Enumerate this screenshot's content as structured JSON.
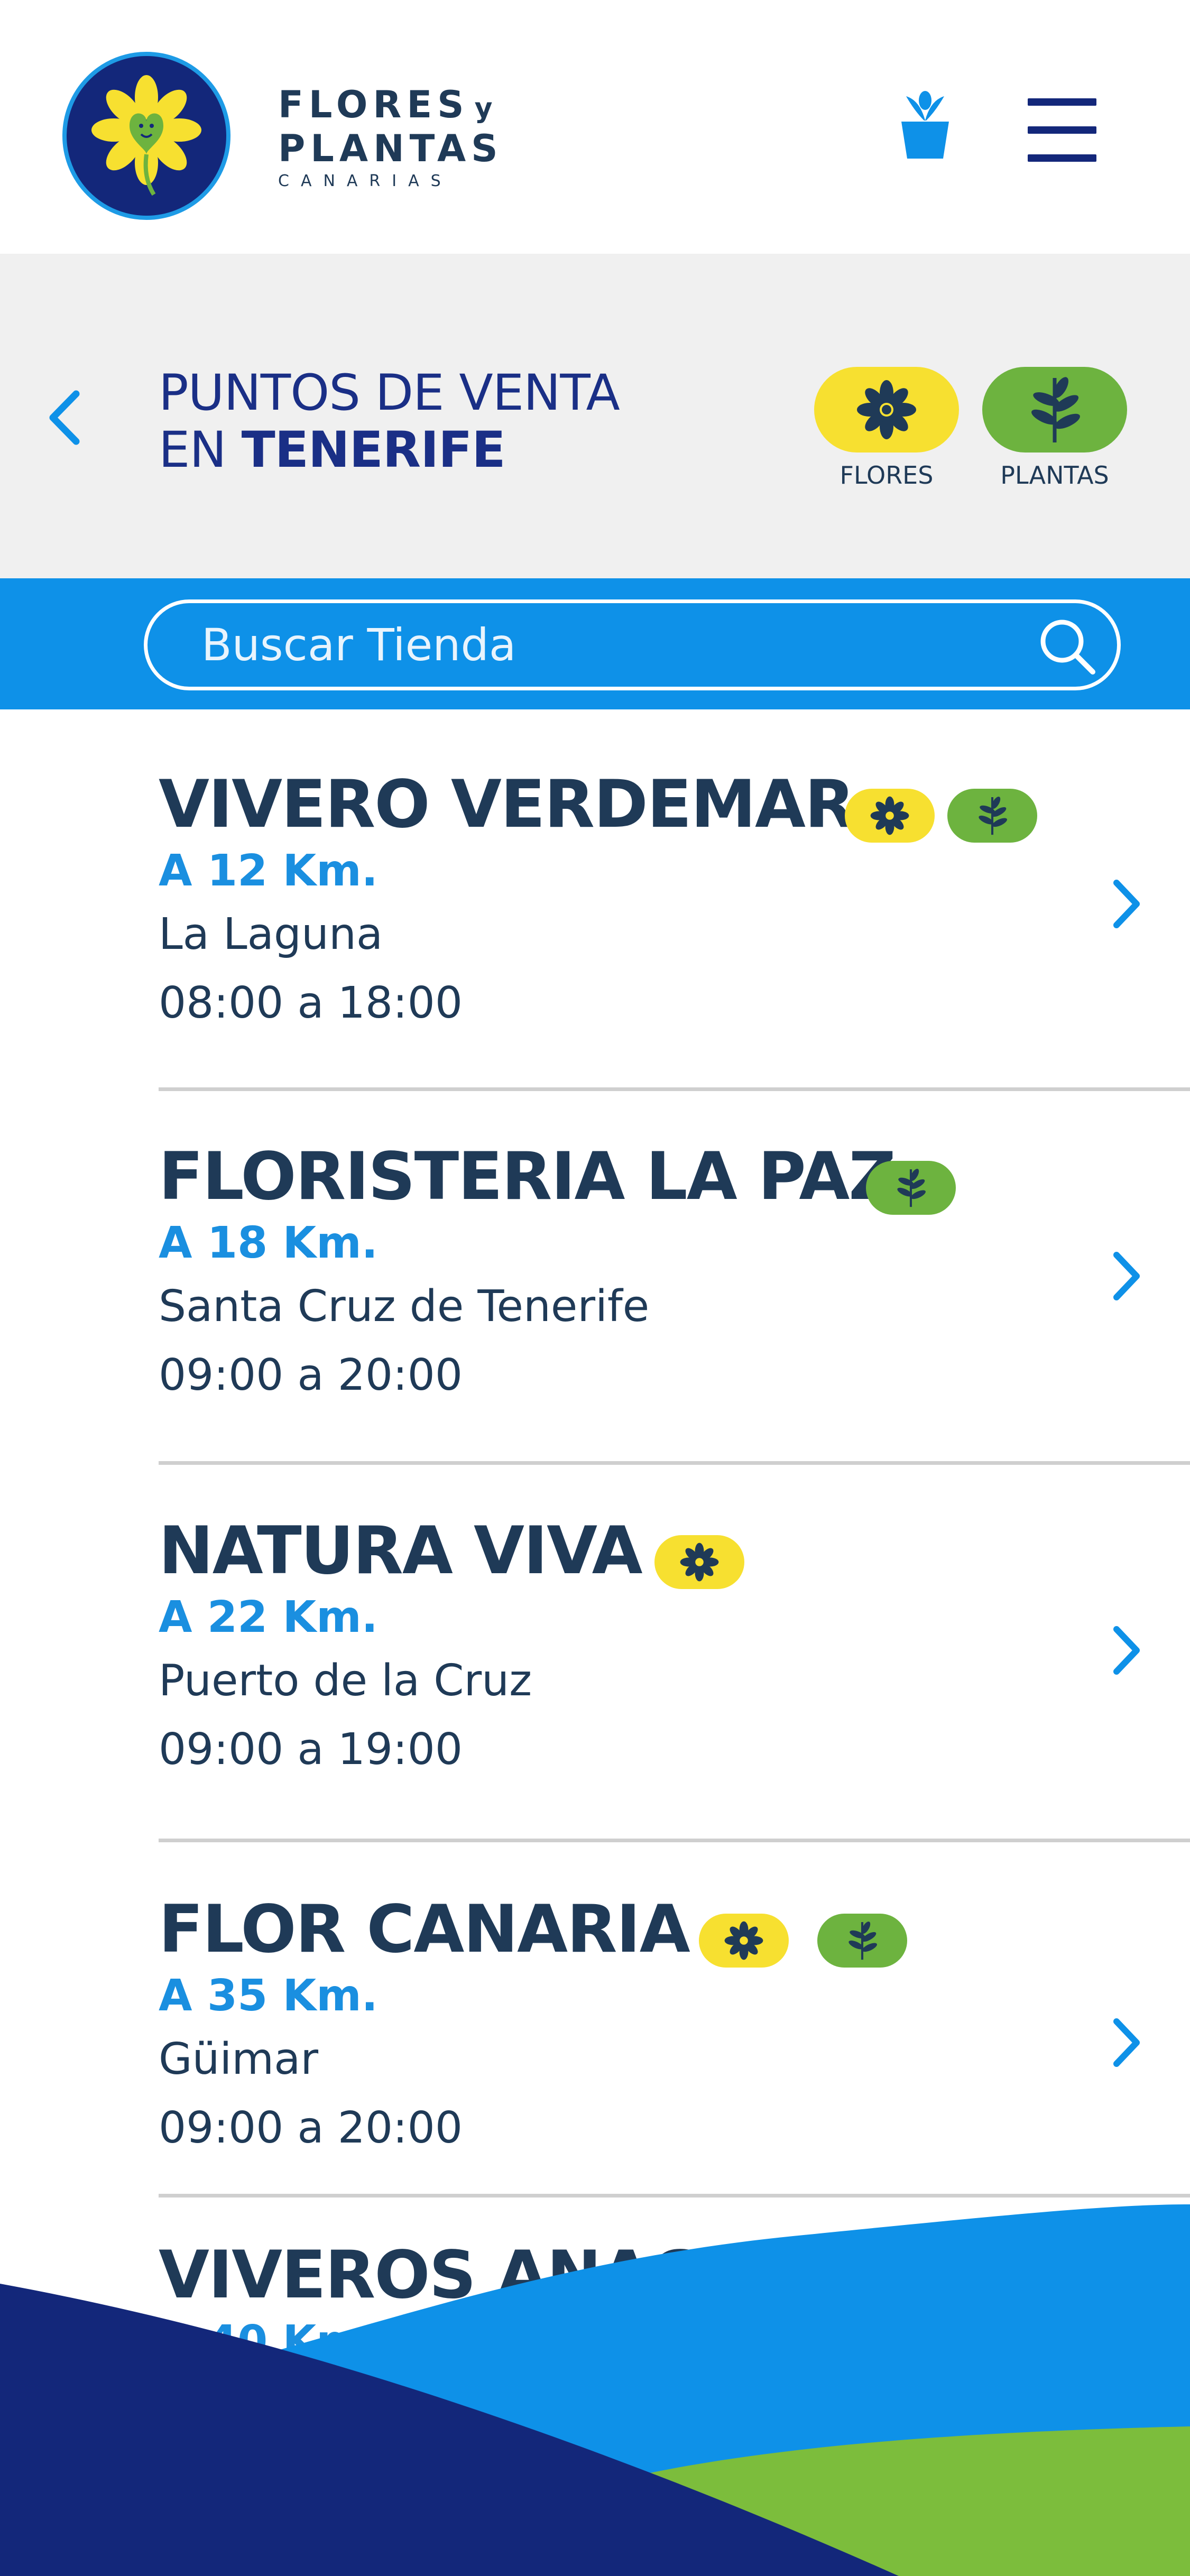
{
  "brand": {
    "line1": "FLORES",
    "line1_small": "y",
    "line2": "PLANTAS",
    "line3": "CANARIAS"
  },
  "icons": {
    "gift": "flower-pot-icon",
    "menu": "hamburger-menu-icon",
    "back": "chevron-left-icon",
    "search": "search-icon",
    "arrow": "chevron-right-icon",
    "flower": "flower-icon",
    "plant": "leaf-icon"
  },
  "colors": {
    "navy": "#13277a",
    "blue": "#0e91e8",
    "yellow": "#f7e030",
    "green": "#6db33f",
    "text": "#1f3a57",
    "accent": "#1a8fe0"
  },
  "page": {
    "title_line1": "PUNTOS DE VENTA",
    "title_line2_prefix": "EN ",
    "title_line2_bold": "TENERIFE"
  },
  "filters": [
    {
      "label": "FLORES"
    },
    {
      "label": "PLANTAS"
    }
  ],
  "search": {
    "placeholder": "Buscar Tienda"
  },
  "stores": [
    {
      "name": "VIVERO VERDEMAR",
      "distance": "A 12 Km.",
      "city": "La Laguna",
      "hours": "08:00 a 18:00",
      "flores": true,
      "plantas": true
    },
    {
      "name": "FLORISTERIA LA PAZ",
      "distance": "A 18 Km.",
      "city": "Santa Cruz de Tenerife",
      "hours": "09:00 a 20:00",
      "flores": false,
      "plantas": true
    },
    {
      "name": "NATURA VIVA",
      "distance": "A 22 Km.",
      "city": "Puerto de la Cruz",
      "hours": "09:00 a 19:00",
      "flores": true,
      "plantas": false
    },
    {
      "name": "FLOR CANARIA",
      "distance": "A 35 Km.",
      "city": "Güimar",
      "hours": "09:00 a 20:00",
      "flores": true,
      "plantas": true
    },
    {
      "name": "VIVEROS ANAGA",
      "distance": "A 40 Km.",
      "flores": true,
      "plantas": false
    }
  ]
}
